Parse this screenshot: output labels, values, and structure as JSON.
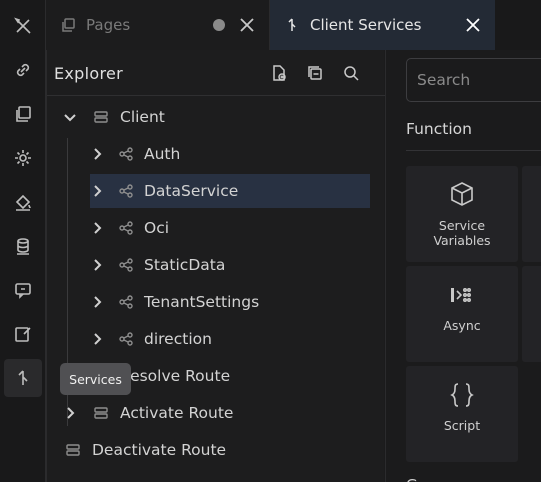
{
  "activity_bar": {
    "items": [
      {
        "name": "tools"
      },
      {
        "name": "link"
      },
      {
        "name": "pages"
      },
      {
        "name": "settings"
      },
      {
        "name": "theme"
      },
      {
        "name": "database"
      },
      {
        "name": "chat"
      },
      {
        "name": "edit"
      },
      {
        "name": "services"
      }
    ],
    "tooltip": "Services"
  },
  "tabs": [
    {
      "label": "Pages",
      "state": "inactive",
      "modified": true
    },
    {
      "label": "Client Services",
      "state": "active"
    }
  ],
  "explorer": {
    "title": "Explorer",
    "tree": [
      {
        "label": "Client",
        "expanded": true
      },
      {
        "label": "Auth"
      },
      {
        "label": "DataService",
        "selected": true
      },
      {
        "label": "Oci"
      },
      {
        "label": "StaticData"
      },
      {
        "label": "TenantSettings"
      },
      {
        "label": "direction"
      },
      {
        "label": "Resolve Route"
      },
      {
        "label": "Activate Route"
      },
      {
        "label": "Deactivate Route"
      }
    ]
  },
  "right_panel": {
    "search_placeholder": "Search",
    "section_title": "Function",
    "cards": [
      {
        "label": "Service\nVariables",
        "icon": "cube-icon"
      },
      {
        "label": "Async",
        "icon": "async-icon"
      },
      {
        "label": "Script",
        "icon": "braces-icon"
      }
    ],
    "next_section_partial": "G"
  },
  "colors": {
    "accent_tab": "#232a35",
    "selected_row": "#283142",
    "background": "#1b1b1c"
  }
}
